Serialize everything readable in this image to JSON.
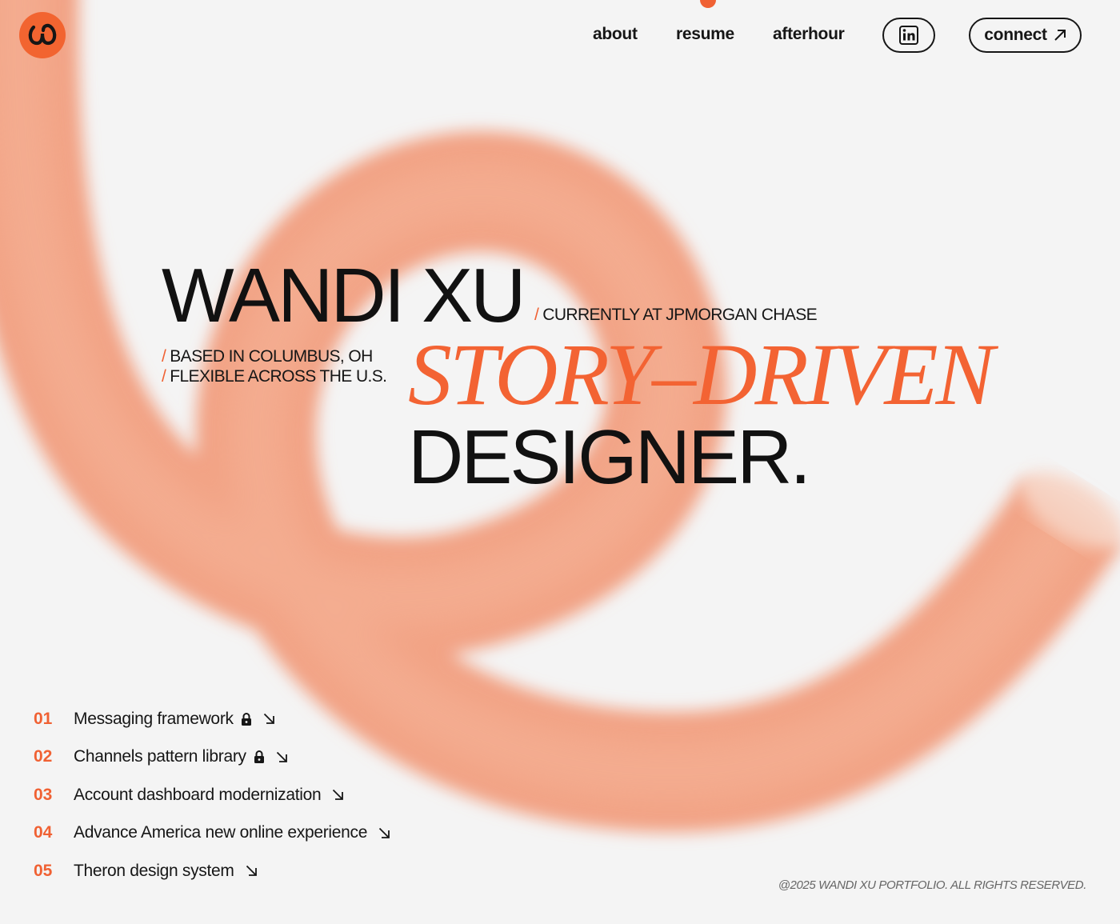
{
  "colors": {
    "accent": "#f06133",
    "text": "#161616",
    "background": "#f4f4f4",
    "tube": "#f2a284"
  },
  "header": {
    "logo_icon": "wandi-logo-icon",
    "nav": [
      {
        "label": "about"
      },
      {
        "label": "resume"
      },
      {
        "label": "afterhour"
      }
    ],
    "linkedin_icon": "linkedin-icon",
    "connect": {
      "label": "connect",
      "icon": "arrow-up-right-icon"
    }
  },
  "hero": {
    "name": "WANDI XU",
    "currently": "CURRENTLY AT JPMORGAN CHASE",
    "location_line1": "BASED IN COLUMBUS, OH",
    "location_line2": "FLEXIBLE ACROSS THE U.S.",
    "slash": "/",
    "tagline_accent": "STORY–DRIVEN",
    "tagline_main": "DESIGNER."
  },
  "projects": [
    {
      "number": "01",
      "title": "Messaging framework",
      "locked": true
    },
    {
      "number": "02",
      "title": "Channels pattern library",
      "locked": true
    },
    {
      "number": "03",
      "title": "Account dashboard modernization",
      "locked": false
    },
    {
      "number": "04",
      "title": "Advance America new online experience",
      "locked": false
    },
    {
      "number": "05",
      "title": "Theron design system",
      "locked": false
    }
  ],
  "footer": {
    "copyright": "@2025 WANDI XU PORTFOLIO. ALL RIGHTS RESERVED."
  }
}
